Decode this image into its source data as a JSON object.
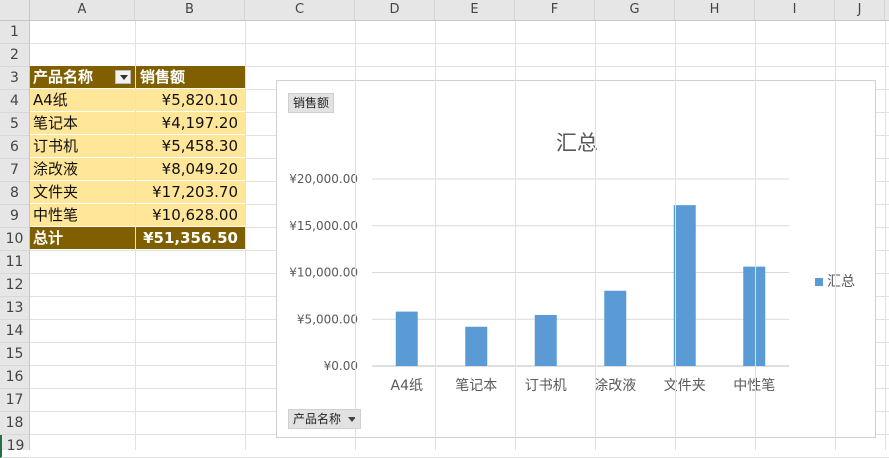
{
  "columns": [
    "A",
    "B",
    "C",
    "D",
    "E",
    "F",
    "G",
    "H",
    "I",
    "J"
  ],
  "rows": [
    "1",
    "2",
    "3",
    "4",
    "5",
    "6",
    "7",
    "8",
    "9",
    "10",
    "11",
    "12",
    "13",
    "14",
    "15",
    "16",
    "17",
    "18",
    "19"
  ],
  "pivot": {
    "header_name": "产品名称",
    "header_value": "销售额",
    "items": [
      {
        "name": "A4纸",
        "value": "¥5,820.10"
      },
      {
        "name": "笔记本",
        "value": "¥4,197.20"
      },
      {
        "name": "订书机",
        "value": "¥5,458.30"
      },
      {
        "name": "涂改液",
        "value": "¥8,049.20"
      },
      {
        "name": "文件夹",
        "value": "¥17,203.70"
      },
      {
        "name": "中性笔",
        "value": "¥10,628.00"
      }
    ],
    "total_label": "总计",
    "total_value": "¥51,356.50"
  },
  "chart": {
    "value_field_button": "销售额",
    "axis_field_button": "产品名称"
  },
  "chart_data": {
    "type": "bar",
    "title": "汇总",
    "categories": [
      "A4纸",
      "笔记本",
      "订书机",
      "涂改液",
      "文件夹",
      "中性笔"
    ],
    "series": [
      {
        "name": "汇总",
        "values": [
          5820.1,
          4197.2,
          5458.3,
          8049.2,
          17203.7,
          10628.0
        ],
        "color": "#5b9bd5"
      }
    ],
    "ylim": [
      0,
      20000
    ],
    "yticks": [
      "¥0.00",
      "¥5,000.00",
      "¥10,000.00",
      "¥15,000.00",
      "¥20,000.00"
    ],
    "ytick_values": [
      0,
      5000,
      10000,
      15000,
      20000
    ],
    "xlabel": "",
    "ylabel": "",
    "grid": true,
    "legend": "right"
  }
}
